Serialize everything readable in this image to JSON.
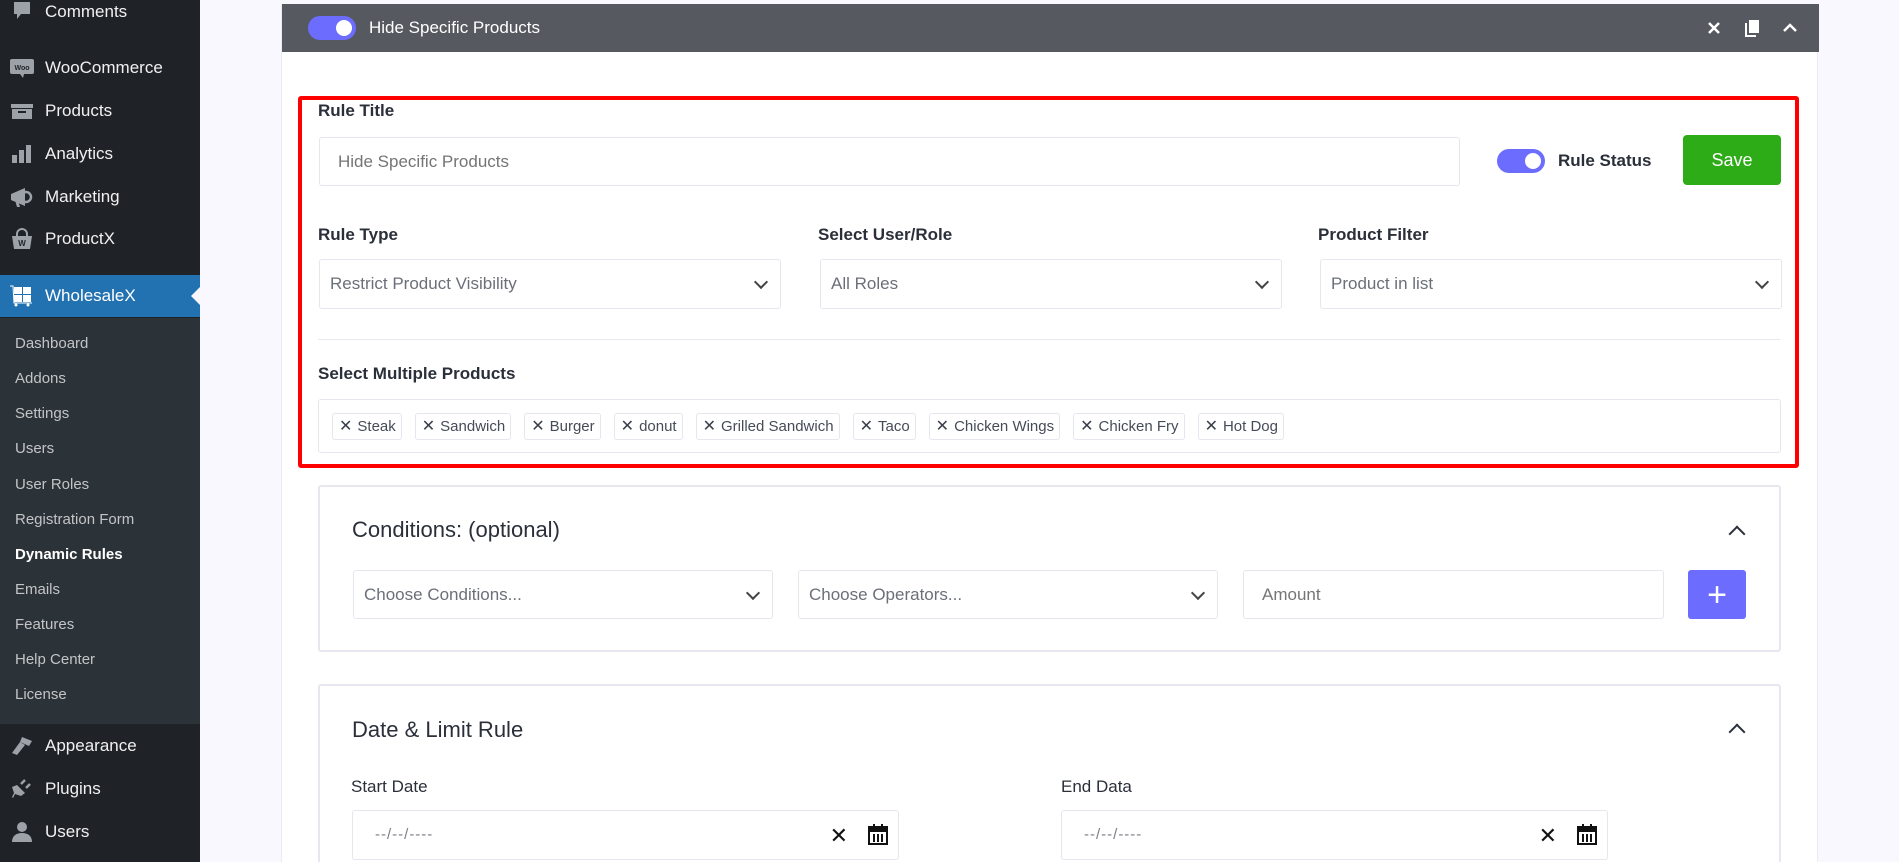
{
  "sidebar": {
    "top_items": [
      {
        "label": "Comments",
        "icon": "comment-icon"
      },
      {
        "label": "WooCommerce",
        "icon": "woocommerce-icon"
      },
      {
        "label": "Products",
        "icon": "archive-box-icon"
      },
      {
        "label": "Analytics",
        "icon": "bar-chart-icon"
      },
      {
        "label": "Marketing",
        "icon": "megaphone-icon"
      },
      {
        "label": "ProductX",
        "icon": "basket-icon"
      },
      {
        "label": "WholesaleX",
        "icon": "wholesalex-icon",
        "active": true
      }
    ],
    "submenu": [
      {
        "label": "Dashboard"
      },
      {
        "label": "Addons"
      },
      {
        "label": "Settings"
      },
      {
        "label": "Users"
      },
      {
        "label": "User Roles"
      },
      {
        "label": "Registration Form"
      },
      {
        "label": "Dynamic Rules",
        "current": true
      },
      {
        "label": "Emails"
      },
      {
        "label": "Features"
      },
      {
        "label": "Help Center"
      },
      {
        "label": "License"
      }
    ],
    "bottom_items": [
      {
        "label": "Appearance",
        "icon": "paintbrush-icon"
      },
      {
        "label": "Plugins",
        "icon": "plug-icon"
      },
      {
        "label": "Users",
        "icon": "user-icon"
      }
    ]
  },
  "rule_card": {
    "header_title": "Hide Specific Products",
    "header_enabled": true,
    "actions": {
      "delete": "close-icon",
      "duplicate": "copy-icon",
      "collapse": "chevron-up-icon"
    }
  },
  "form": {
    "rule_title_label": "Rule Title",
    "rule_title_placeholder": "Hide Specific Products",
    "rule_status_label": "Rule Status",
    "rule_status_enabled": true,
    "save_label": "Save",
    "rule_type_label": "Rule Type",
    "rule_type_value": "Restrict Product Visibility",
    "user_role_label": "Select User/Role",
    "user_role_value": "All Roles",
    "product_filter_label": "Product Filter",
    "product_filter_value": "Product in list",
    "products_label": "Select Multiple Products",
    "products": [
      "Steak",
      "Sandwich",
      "Burger",
      "donut",
      "Grilled Sandwich",
      "Taco",
      "Chicken Wings",
      "Chicken Fry",
      "Hot Dog"
    ]
  },
  "conditions": {
    "title": "Conditions: (optional)",
    "condition_placeholder": "Choose Conditions...",
    "operator_placeholder": "Choose Operators...",
    "amount_placeholder": "Amount",
    "add_label": "+"
  },
  "date_limit": {
    "title": "Date & Limit Rule",
    "start_label": "Start Date",
    "start_placeholder": "--/--/----",
    "end_label": "End Data",
    "end_placeholder": "--/--/----"
  },
  "colors": {
    "accent": "#6c6cff",
    "save": "#2eac17",
    "sidebar_active": "#2271b1",
    "highlight": "#ff0000"
  }
}
